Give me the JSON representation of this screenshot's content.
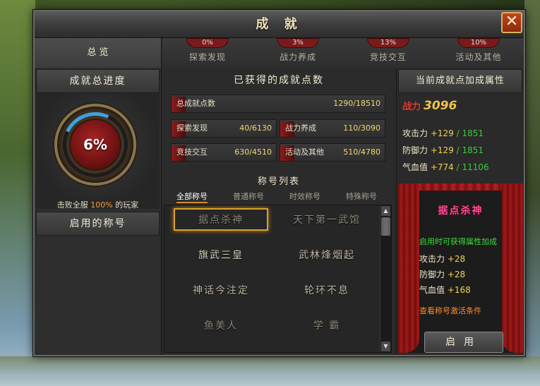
{
  "window": {
    "title": "成 就",
    "close": "✕"
  },
  "tabs": {
    "overview": "总 览",
    "categories": [
      {
        "label": "探索发现",
        "pct": "0%"
      },
      {
        "label": "战力养成",
        "pct": "3%"
      },
      {
        "label": "竞技交互",
        "pct": "13%"
      },
      {
        "label": "活动及其他",
        "pct": "10%"
      }
    ]
  },
  "left": {
    "progress_heading": "成就总进度",
    "progress_pct": "6%",
    "progress_value": 0.06,
    "beat_prefix": "击败全服 ",
    "beat_pct": "100%",
    "beat_suffix": " 的玩家",
    "enabled_title_heading": "启用的称号"
  },
  "middle": {
    "points_heading": "已获得的成就点数",
    "total": {
      "label": "总成就点数",
      "value": "1290/18510"
    },
    "stats": [
      {
        "label": "探索发现",
        "value": "40/6130"
      },
      {
        "label": "战力养成",
        "value": "110/3090"
      },
      {
        "label": "竞技交互",
        "value": "630/4510"
      },
      {
        "label": "活动及其他",
        "value": "510/4780"
      }
    ],
    "titles_heading": "称号列表",
    "filters": [
      "全部称号",
      "普通称号",
      "时效称号",
      "特殊称号"
    ],
    "active_filter": "全部称号",
    "titles": [
      "据点杀神",
      "天下第一武馆",
      "旗武三皇",
      "武林烽烟起",
      "神话今注定",
      "轮环不息",
      "鱼美人",
      "学 霸"
    ]
  },
  "right": {
    "bonus_heading": "当前成就点加成属性",
    "power_label": "战力",
    "power_value": "3096",
    "attrs": [
      {
        "label": "攻击力",
        "plus": "+129",
        "max": "/ 1851"
      },
      {
        "label": "防御力",
        "plus": "+129",
        "max": "/ 1851"
      },
      {
        "label": "气血值",
        "plus": "+774",
        "max": "/ 11106"
      }
    ],
    "selected_title": "据点杀神",
    "enable_hint": "启用时可获得属性加成",
    "title_bonus": [
      {
        "label": "攻击力",
        "plus": "+28"
      },
      {
        "label": "防御力",
        "plus": "+28"
      },
      {
        "label": "气血值",
        "plus": "+168"
      }
    ],
    "condition_link": "查看称号激活条件",
    "enable_button": "启用"
  },
  "colors": {
    "accent_red": "#8a1c1c",
    "gold": "#f2c34a",
    "green": "#3acc3a",
    "orange": "#ff9a3a"
  }
}
